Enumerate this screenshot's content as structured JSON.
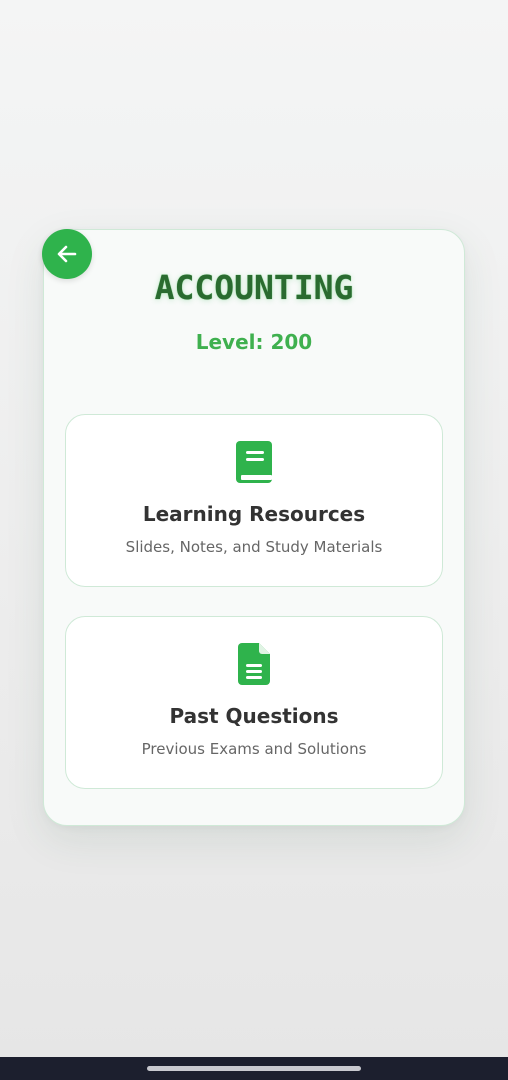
{
  "page": {
    "title": "ACCOUNTING",
    "level": "Level: 200"
  },
  "options": [
    {
      "title": "Learning Resources",
      "subtitle": "Slides, Notes, and Study Materials",
      "icon": "book-icon"
    },
    {
      "title": "Past Questions",
      "subtitle": "Previous Exams and Solutions",
      "icon": "document-icon"
    }
  ],
  "back_button": {
    "icon": "arrow-left-icon"
  },
  "colors": {
    "accent": "#2fb34c",
    "title": "#2a6b30",
    "border": "#cfe9d7",
    "nav_bar": "#1c1f2e"
  }
}
